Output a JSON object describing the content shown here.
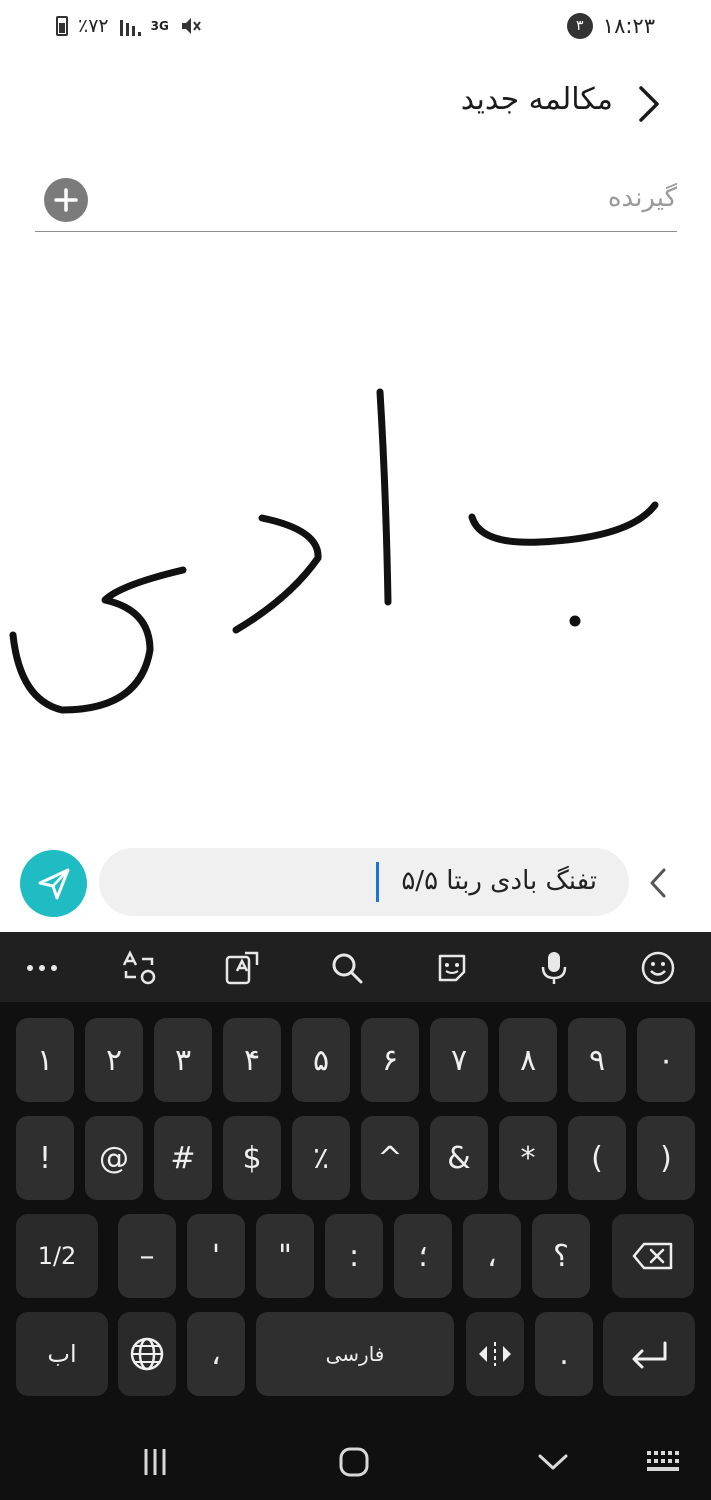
{
  "status_bar": {
    "time": "۱۸:۲۳",
    "notification_count": "۳",
    "battery": "٪۷۲",
    "network": "3G"
  },
  "header": {
    "title": "مکالمه جدید"
  },
  "recipient": {
    "placeholder": "گیرنده"
  },
  "composer": {
    "message": "تفنگ بادی ربتا ۵/۵"
  },
  "keyboard": {
    "row1": [
      "۱",
      "۲",
      "۳",
      "۴",
      "۵",
      "۶",
      "۷",
      "۸",
      "۹",
      "۰"
    ],
    "row2": [
      "!",
      "@",
      "#",
      "$",
      "٪",
      "^",
      "&",
      "*",
      "(",
      ")"
    ],
    "row3": [
      "1/2",
      "–",
      "'",
      "\"",
      ":",
      "؛",
      "،",
      "؟"
    ],
    "row4": {
      "lang_switch": "اب",
      "comma": "،",
      "space": "فارسی",
      "period": "."
    }
  },
  "colors": {
    "accent": "#1fbcc4",
    "keyboard_bg": "#101010",
    "key_bg": "#2f2f2f",
    "caret": "#1976d2"
  }
}
